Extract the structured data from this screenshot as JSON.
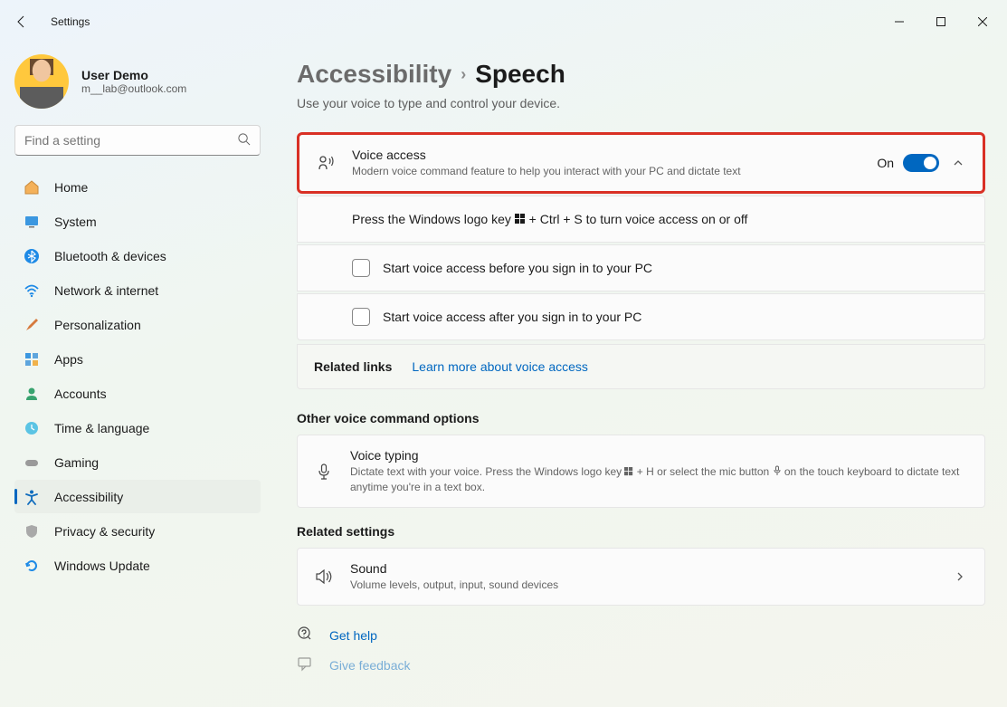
{
  "app": {
    "title": "Settings"
  },
  "user": {
    "name": "User Demo",
    "email": "m__lab@outlook.com"
  },
  "search": {
    "placeholder": "Find a setting"
  },
  "nav": {
    "items": [
      {
        "label": "Home"
      },
      {
        "label": "System"
      },
      {
        "label": "Bluetooth & devices"
      },
      {
        "label": "Network & internet"
      },
      {
        "label": "Personalization"
      },
      {
        "label": "Apps"
      },
      {
        "label": "Accounts"
      },
      {
        "label": "Time & language"
      },
      {
        "label": "Gaming"
      },
      {
        "label": "Accessibility"
      },
      {
        "label": "Privacy & security"
      },
      {
        "label": "Windows Update"
      }
    ]
  },
  "breadcrumb": {
    "parent": "Accessibility",
    "current": "Speech"
  },
  "subtitle": "Use your voice to type and control your device.",
  "voiceAccess": {
    "title": "Voice access",
    "desc": "Modern voice command feature to help you interact with your PC and dictate text",
    "toggleLabel": "On",
    "hotkeyPrefix": "Press the Windows logo key ",
    "hotkeySuffix": " + Ctrl + S to turn voice access on or off",
    "opt1": "Start voice access before you sign in to your PC",
    "opt2": "Start voice access after you sign in to your PC"
  },
  "related": {
    "label": "Related links",
    "link": "Learn more about voice access"
  },
  "otherSection": "Other voice command options",
  "voiceTyping": {
    "title": "Voice typing",
    "descPrefix": "Dictate text with your voice. Press the Windows logo key ",
    "descMid": " + H or select the mic button ",
    "descSuffix": " on the touch keyboard to dictate text anytime you're in a text box."
  },
  "relatedSettings": "Related settings",
  "sound": {
    "title": "Sound",
    "desc": "Volume levels, output, input, sound devices"
  },
  "help": {
    "getHelp": "Get help",
    "feedback": "Give feedback"
  }
}
